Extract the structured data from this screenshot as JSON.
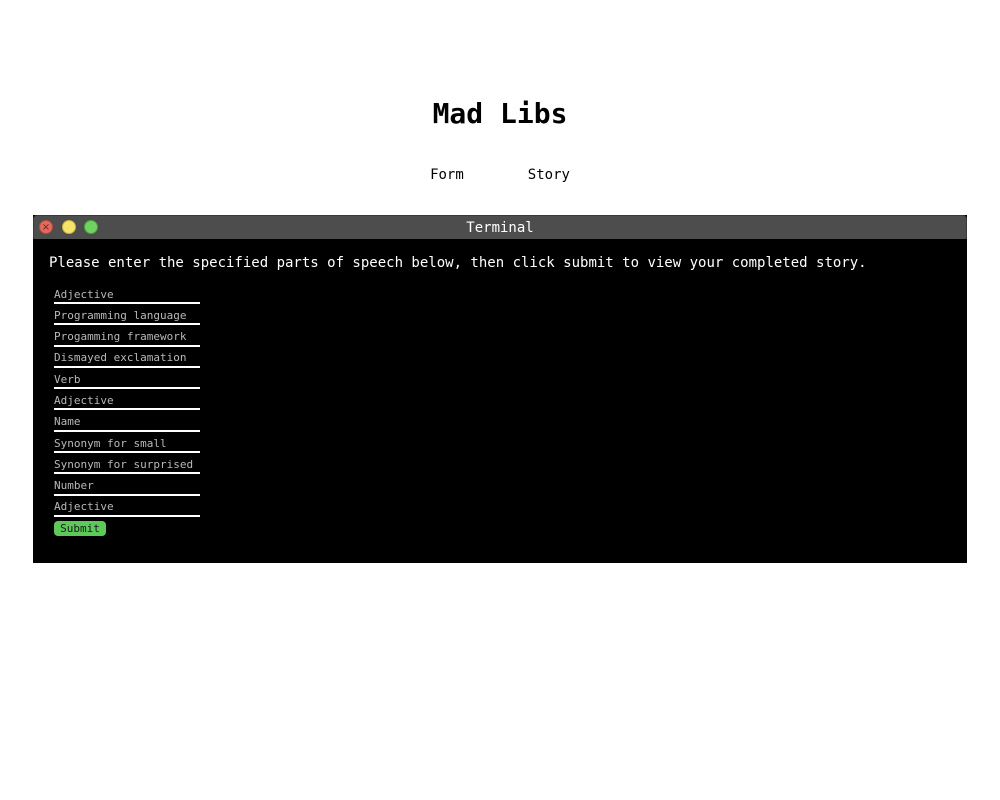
{
  "page": {
    "title": "Mad Libs"
  },
  "nav": {
    "items": [
      {
        "label": "Form"
      },
      {
        "label": "Story"
      }
    ]
  },
  "terminal": {
    "title": "Terminal",
    "controls": {
      "close_icon": "×",
      "minimize_icon": "–",
      "maximize_icon": "□"
    },
    "instructions": "Please enter the specified parts of speech below, then click submit to view your completed story.",
    "fields": [
      {
        "placeholder": "Adjective",
        "value": ""
      },
      {
        "placeholder": "Programming language",
        "value": ""
      },
      {
        "placeholder": "Progamming framework",
        "value": ""
      },
      {
        "placeholder": "Dismayed exclamation",
        "value": ""
      },
      {
        "placeholder": "Verb",
        "value": ""
      },
      {
        "placeholder": "Adjective",
        "value": ""
      },
      {
        "placeholder": "Name",
        "value": ""
      },
      {
        "placeholder": "Synonym for small",
        "value": ""
      },
      {
        "placeholder": "Synonym for surprised",
        "value": ""
      },
      {
        "placeholder": "Number",
        "value": ""
      },
      {
        "placeholder": "Adjective",
        "value": ""
      }
    ],
    "submit_label": "Submit"
  },
  "colors": {
    "terminal_bg": "#000000",
    "titlebar_bg": "#4d4d4d",
    "submit_bg": "#5cc959",
    "close": "#e06c5f",
    "minimize": "#f5e36c",
    "maximize": "#70d260"
  }
}
